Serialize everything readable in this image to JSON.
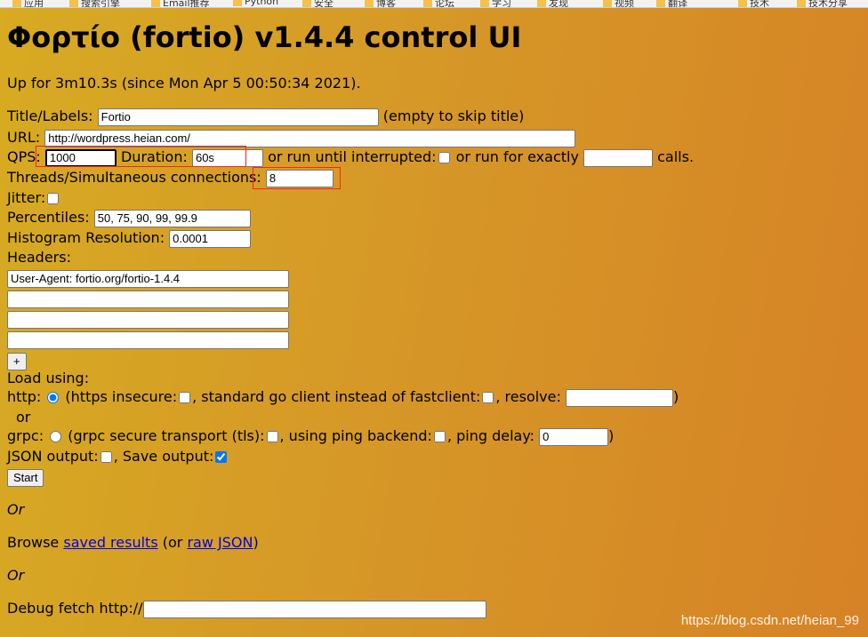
{
  "bookmarks": [
    "应用",
    "搜索引擎",
    "Email推荐",
    "Python",
    "安全",
    "博客",
    "论坛",
    "学习",
    "发现",
    "视频",
    "翻译",
    "技术",
    "技术分享"
  ],
  "title": "Φορτίο (fortio) v1.4.4 control UI",
  "uptime": "Up for 3m10.3s (since Mon Apr 5 00:50:34 2021).",
  "form": {
    "title_label": "Title/Labels:",
    "title_value": "Fortio",
    "title_hint": "(empty to skip title)",
    "url_label": "URL:",
    "url_value": "http://wordpress.heian.com/",
    "qps_label": "QPS:",
    "qps_value": "1000",
    "duration_label": "Duration:",
    "duration_value": "60s",
    "until_interrupted_label": "or run until interrupted:",
    "exactly_label": "or run for exactly",
    "calls_label": "calls.",
    "threads_label": "Threads/Simultaneous connections:",
    "threads_value": "8",
    "jitter_label": "Jitter:",
    "percentiles_label": "Percentiles:",
    "percentiles_value": "50, 75, 90, 99, 99.9",
    "histogram_label": "Histogram Resolution:",
    "histogram_value": "0.0001",
    "headers_label": "Headers:",
    "headers": [
      "User-Agent: fortio.org/fortio-1.4.4",
      "",
      "",
      ""
    ],
    "add_header_label": "+",
    "load_using_label": "Load using:",
    "http_label": "http:",
    "https_insecure_label": "(https insecure:",
    "std_client_label": ", standard go client instead of fastclient:",
    "resolve_label": ", resolve:",
    "close_paren": ")",
    "or_label": "or",
    "grpc_label": "grpc:",
    "grpc_secure_label": "(grpc secure transport (tls):",
    "ping_backend_label": ", using ping backend:",
    "ping_delay_label": ", ping delay:",
    "ping_delay_value": "0",
    "json_output_label": "JSON output:",
    "save_output_label": ", Save output:",
    "start_label": "Start"
  },
  "or_text": "Or",
  "browse": {
    "prefix": "Browse",
    "saved_results": "saved results",
    "mid": "(or",
    "raw_json": "raw JSON",
    "suffix": ")"
  },
  "debug_fetch_label": "Debug fetch http://",
  "watermark": "https://blog.csdn.net/heian_99"
}
